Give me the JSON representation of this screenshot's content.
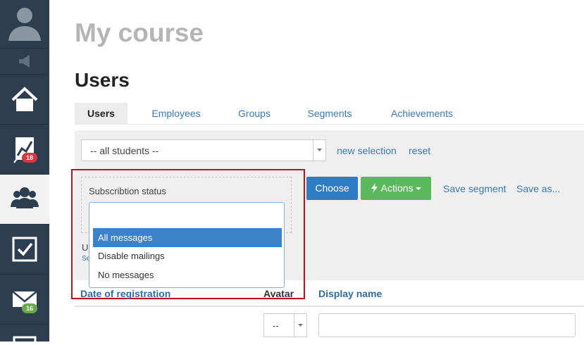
{
  "page": {
    "course_title": "My course",
    "section_title": "Users"
  },
  "sidebar": {
    "items": [
      {
        "name": "avatar",
        "icon": "user-silhouette-icon"
      },
      {
        "name": "announcement",
        "icon": "megaphone-icon"
      },
      {
        "name": "home",
        "icon": "home-icon"
      },
      {
        "name": "stats",
        "icon": "chart-icon",
        "badge": "18",
        "badge_color": "#d9363e"
      },
      {
        "name": "users",
        "icon": "users-group-icon",
        "active": true
      },
      {
        "name": "tasks",
        "icon": "checkbox-icon"
      },
      {
        "name": "messages",
        "icon": "envelope-icon",
        "badge": "16",
        "badge_color": "#6aa84f"
      }
    ]
  },
  "tabs": [
    {
      "label": "Users",
      "active": true
    },
    {
      "label": "Employees"
    },
    {
      "label": "Groups"
    },
    {
      "label": "Segments"
    },
    {
      "label": "Achievements"
    }
  ],
  "filters": {
    "selection_value": "-- all students --",
    "new_selection": "new selection",
    "reset": "reset",
    "subscription_label": "Subscribtion status",
    "partial_label_1": "U",
    "partial_label_2": "Se"
  },
  "toolbar": {
    "choose": "Choose",
    "actions": "Actions",
    "save_segment": "Save segment",
    "save_as": "Save as..."
  },
  "dropdown": {
    "search_value": "",
    "options": [
      {
        "label": "All messages",
        "selected": true
      },
      {
        "label": "Disable mailings"
      },
      {
        "label": "No messages"
      }
    ]
  },
  "table": {
    "columns": [
      "Date of registration",
      "Avatar",
      "Display name"
    ],
    "avatar_filter_value": "--",
    "display_name_value": ""
  },
  "colors": {
    "sidebar_bg": "#2d3e50",
    "link": "#3a7ab5",
    "primary_button": "#2e7cc4",
    "success_button": "#5cb85c",
    "highlight_box": "#c0111a"
  }
}
